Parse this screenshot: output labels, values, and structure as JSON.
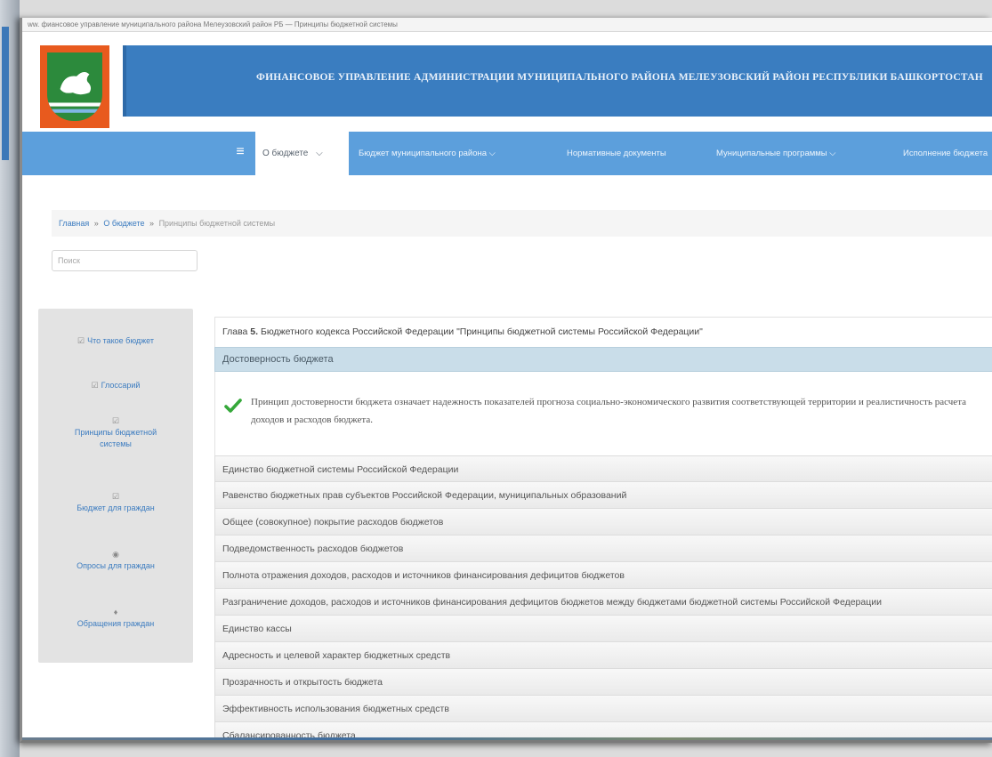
{
  "browser": {
    "url_text": "ww. фиансовое управление муниципального района Мелеузовский район РБ — Принципы бюджетной системы"
  },
  "header": {
    "title": "ФИНАНСОВОЕ УПРАВЛЕНИЕ АДМИНИСТРАЦИИ МУНИЦИПАЛЬНОГО РАЙОНА МЕЛЕУЗОВСКИЙ РАЙОН РЕСПУБЛИКИ БАШКОРТОСТАН",
    "colors": {
      "banner": "#3a7dc0",
      "nav": "#5c9fdc",
      "logo": "#e85a1e"
    }
  },
  "nav": {
    "menu_icon": "≡",
    "active_label": "О бюджете",
    "active_chevron": "⌵",
    "items": [
      {
        "label": "Бюджет муниципального района ⌵"
      },
      {
        "label": "Нормативные документы"
      },
      {
        "label": "Муниципальные программы ⌵"
      },
      {
        "label": "Исполнение бюджета"
      }
    ]
  },
  "breadcrumb": {
    "home": "Главная",
    "section": "О бюджете",
    "separator": "»",
    "current": "Принципы бюджетной системы"
  },
  "search": {
    "placeholder": "Поиск"
  },
  "sidebar": {
    "items": [
      {
        "icon": "☑",
        "label": "Что такое бюджет"
      },
      {
        "icon": "☑",
        "label": "Глоссарий"
      },
      {
        "icon": "☑",
        "label": "Принципы бюджетной системы"
      },
      {
        "icon": "☑",
        "label": "Бюджет для граждан"
      },
      {
        "icon": "◉",
        "label": "Опросы для граждан"
      },
      {
        "icon": "♦",
        "label": "Обращения граждан"
      }
    ]
  },
  "content": {
    "chapter_prefix": "Глава",
    "chapter_number": "5.",
    "chapter_text": "Бюджетного кодекса Российской Федерации \"Принципы бюджетной системы Российской Федерации\"",
    "active_panel": {
      "title": "Достоверность бюджета",
      "body": "Принцип достоверности бюджета означает надежность показателей прогноза социально-экономического развития соответствующей территории и реалистичность расчета доходов и расходов бюджета."
    },
    "panels": [
      "Единство бюджетной системы Российской Федерации",
      "Равенство бюджетных прав субъектов Российской Федерации, муниципальных образований",
      "Общее (совокупное) покрытие расходов бюджетов",
      "Подведомственность расходов бюджетов",
      "Полнота отражения доходов, расходов и источников финансирования дефицитов бюджетов",
      "Разграничение доходов, расходов и источников финансирования дефицитов бюджетов между бюджетами бюджетной системы Российской Федерации",
      "Единство кассы",
      "Адресность и целевой характер бюджетных средств",
      "Прозрачность и открытость бюджета",
      "Эффективность использования бюджетных средств",
      "Сбалансированность бюджета"
    ]
  }
}
